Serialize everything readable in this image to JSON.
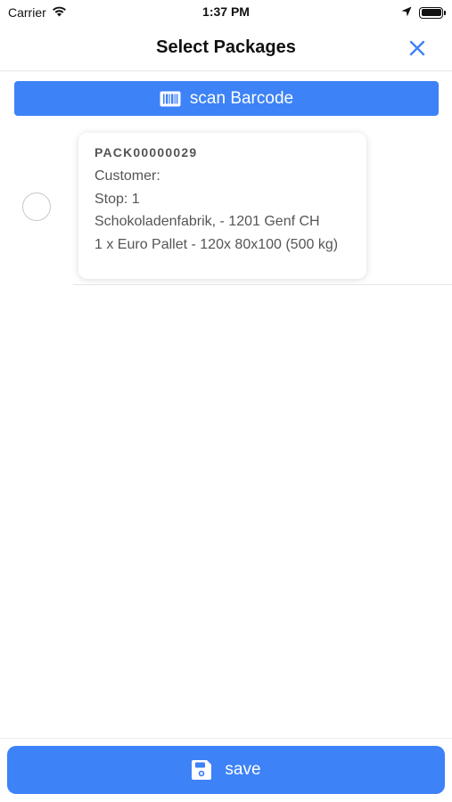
{
  "status_bar": {
    "carrier": "Carrier",
    "time": "1:37 PM",
    "icons": [
      "wifi-icon",
      "location-arrow-icon",
      "battery-icon"
    ]
  },
  "nav": {
    "title": "Select Packages",
    "close_icon": "close-icon"
  },
  "scan_button": {
    "icon": "barcode-icon",
    "label": "scan Barcode"
  },
  "packages": [
    {
      "id": "PACK00000029",
      "customer": "Customer:",
      "stop": "Stop: 1",
      "address": "Schokoladenfabrik, - 1201 Genf CH",
      "contents": "1 x Euro Pallet - 120x 80x100 (500 kg)",
      "selected": false
    }
  ],
  "save_button": {
    "icon": "save-icon",
    "label": "save"
  },
  "colors": {
    "accent": "#3d82f7",
    "text_primary": "#111111",
    "text_secondary": "#555555",
    "divider": "#e6e6e6"
  }
}
